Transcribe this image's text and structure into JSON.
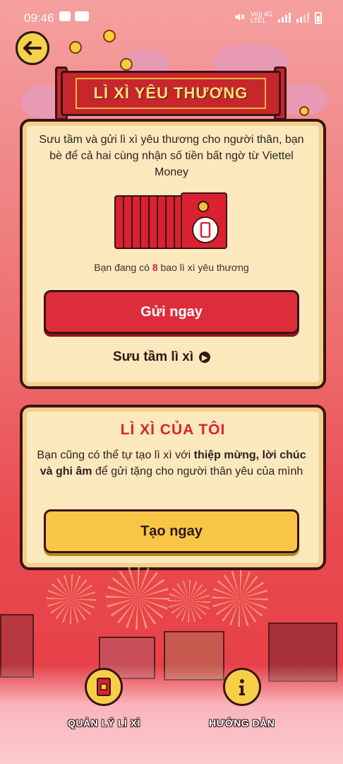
{
  "status_bar": {
    "time": "09:46",
    "network_label_top": "Vo)) 4G",
    "network_label_bottom": "LTE1"
  },
  "colors": {
    "primary_red": "#dd2d3a",
    "accent_yellow": "#f9c547",
    "card_bg": "#fbe8bd",
    "outline": "#3a1414"
  },
  "header": {
    "back_icon": "arrow-left-icon",
    "title": "LÌ XÌ YÊU THƯƠNG"
  },
  "send_card": {
    "description": "Sưu tầm và gửi lì xì yêu thương cho người thân, bạn bè để cả hai cùng nhận số tiền bất ngờ từ Viettel Money",
    "envelope_icon": "red-envelope-stack-icon",
    "count_prefix": "Bạn đang có",
    "count": "8",
    "count_suffix": "bao lì xì yêu thương",
    "send_button": "Gửi ngay",
    "collect_link": "Sưu tầm lì xì"
  },
  "my_card": {
    "title": "LÌ XÌ CỦA TÔI",
    "desc_part1": "Bạn cũng có thể tự tạo lì xì với",
    "desc_bold1": "thiệp mừng, lời chúc và ghi âm",
    "desc_part2": "để gửi tặng cho người thân yêu của mình",
    "create_button": "Tạo ngay"
  },
  "bottom_nav": {
    "items": [
      {
        "label": "QUẢN LÝ LÌ XÌ",
        "icon": "red-envelope-icon"
      },
      {
        "label": "HƯỚNG DẪN",
        "icon": "info-icon"
      }
    ]
  }
}
